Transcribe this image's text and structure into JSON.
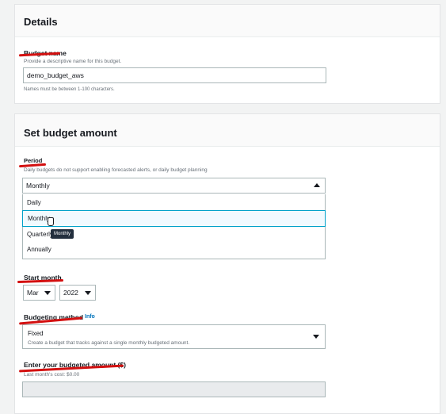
{
  "details": {
    "title": "Details",
    "budget_name_label": "Budget name",
    "budget_name_desc": "Provide a descriptive name for this budget.",
    "budget_name_value": "demo_budget_aws",
    "budget_name_hint": "Names must be between 1-100 characters."
  },
  "amount": {
    "title": "Set budget amount",
    "period_label": "Period",
    "period_desc": "Daily budgets do not support enabling forecasted alerts, or daily budget planning",
    "period_selected": "Monthly",
    "period_options": [
      "Daily",
      "Monthly",
      "Quarterly",
      "Annually"
    ],
    "tooltip": "Monthly",
    "start_month_label": "Start month",
    "month_value": "Mar",
    "year_value": "2022",
    "budgeting_method_label": "Budgeting method",
    "info_link": "Info",
    "method_value": "Fixed",
    "method_desc": "Create a budget that tracks against a single monthly budgeted amount.",
    "budget_amount_label": "Enter your budgeted amount ($)",
    "budget_amount_desc": "Last month's cost: $0.00"
  },
  "colors": {
    "annotation": "#d31010",
    "link": "#0073bb"
  }
}
